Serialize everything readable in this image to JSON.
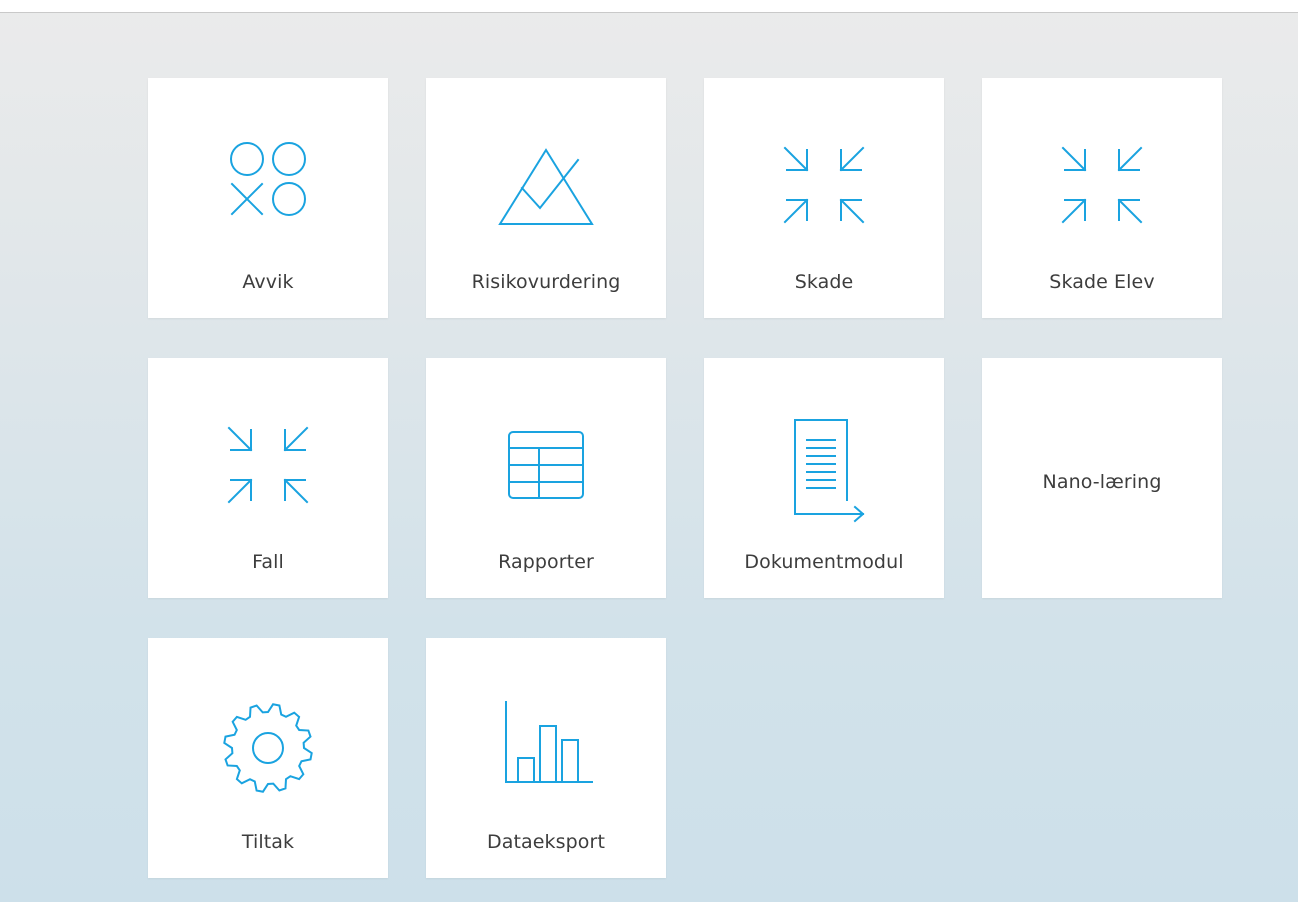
{
  "colors": {
    "accent": "#1aa3e0",
    "tile_background": "#ffffff",
    "label_text": "#3d3d3d"
  },
  "tiles": [
    {
      "label": "Avvik",
      "icon": "avvik-shapes-icon"
    },
    {
      "label": "Risikovurdering",
      "icon": "triangle-mountain-icon"
    },
    {
      "label": "Skade",
      "icon": "compress-arrows-icon"
    },
    {
      "label": "Skade Elev",
      "icon": "compress-arrows-icon"
    },
    {
      "label": "Fall",
      "icon": "compress-arrows-icon"
    },
    {
      "label": "Rapporter",
      "icon": "table-icon"
    },
    {
      "label": "Dokumentmodul",
      "icon": "document-arrow-icon"
    },
    {
      "label": "Nano-læring",
      "icon": ""
    },
    {
      "label": "Tiltak",
      "icon": "gear-icon"
    },
    {
      "label": "Dataeksport",
      "icon": "bar-chart-icon"
    }
  ]
}
